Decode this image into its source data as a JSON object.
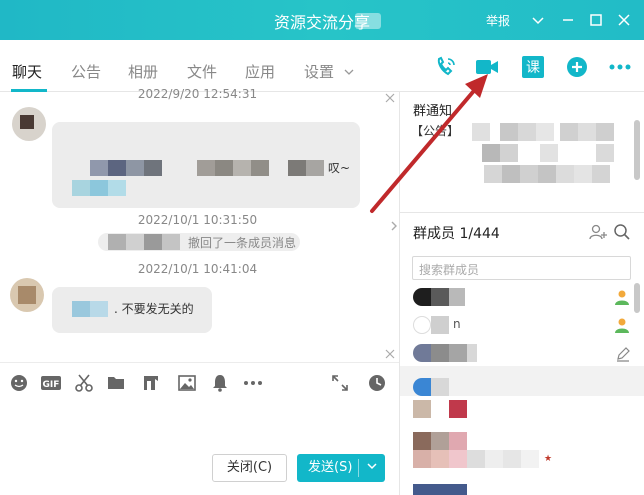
{
  "window": {
    "title": "资源交流分享",
    "report_label": "举报",
    "min_icon": "minimize-icon",
    "max_icon": "maximize-icon",
    "close_icon": "close-icon"
  },
  "tabs": [
    {
      "label": "聊天",
      "active": true
    },
    {
      "label": "公告",
      "active": false
    },
    {
      "label": "相册",
      "active": false
    },
    {
      "label": "文件",
      "active": false
    },
    {
      "label": "应用",
      "active": false
    },
    {
      "label": "设置",
      "active": false
    }
  ],
  "header_actions": [
    {
      "icon": "voice-call-icon"
    },
    {
      "icon": "video-call-icon"
    },
    {
      "icon": "course-icon",
      "text": "课"
    },
    {
      "icon": "add-icon"
    },
    {
      "icon": "more-icon"
    }
  ],
  "chat": {
    "messages": [
      {
        "timestamp": "2022/9/20 12:54:31",
        "text_tail": "叹~"
      },
      {
        "timestamp": "2022/10/1 10:31:50",
        "system": "撤回了一条成员消息"
      },
      {
        "timestamp": "2022/10/1 10:41:04",
        "text": ". 不要发无关的"
      }
    ]
  },
  "composer": {
    "tools": [
      "emoji-icon",
      "gif-icon",
      "scissors-icon",
      "folder-icon",
      "red-packet-icon",
      "image-icon",
      "bell-icon",
      "more-tools-icon",
      "expand-icon",
      "history-icon"
    ],
    "gif_text": "GIF",
    "close_label": "关闭(C)",
    "send_label": "发送(S)"
  },
  "sidebar": {
    "notice_title": "群通知",
    "notice_tag": "【公告】",
    "members_title": "群成员 1/444",
    "search_placeholder": "搜索群成员"
  },
  "colors": {
    "accent": "#12b7c9",
    "title_bar": "#22bcc7",
    "arrow": "#c0292b"
  }
}
